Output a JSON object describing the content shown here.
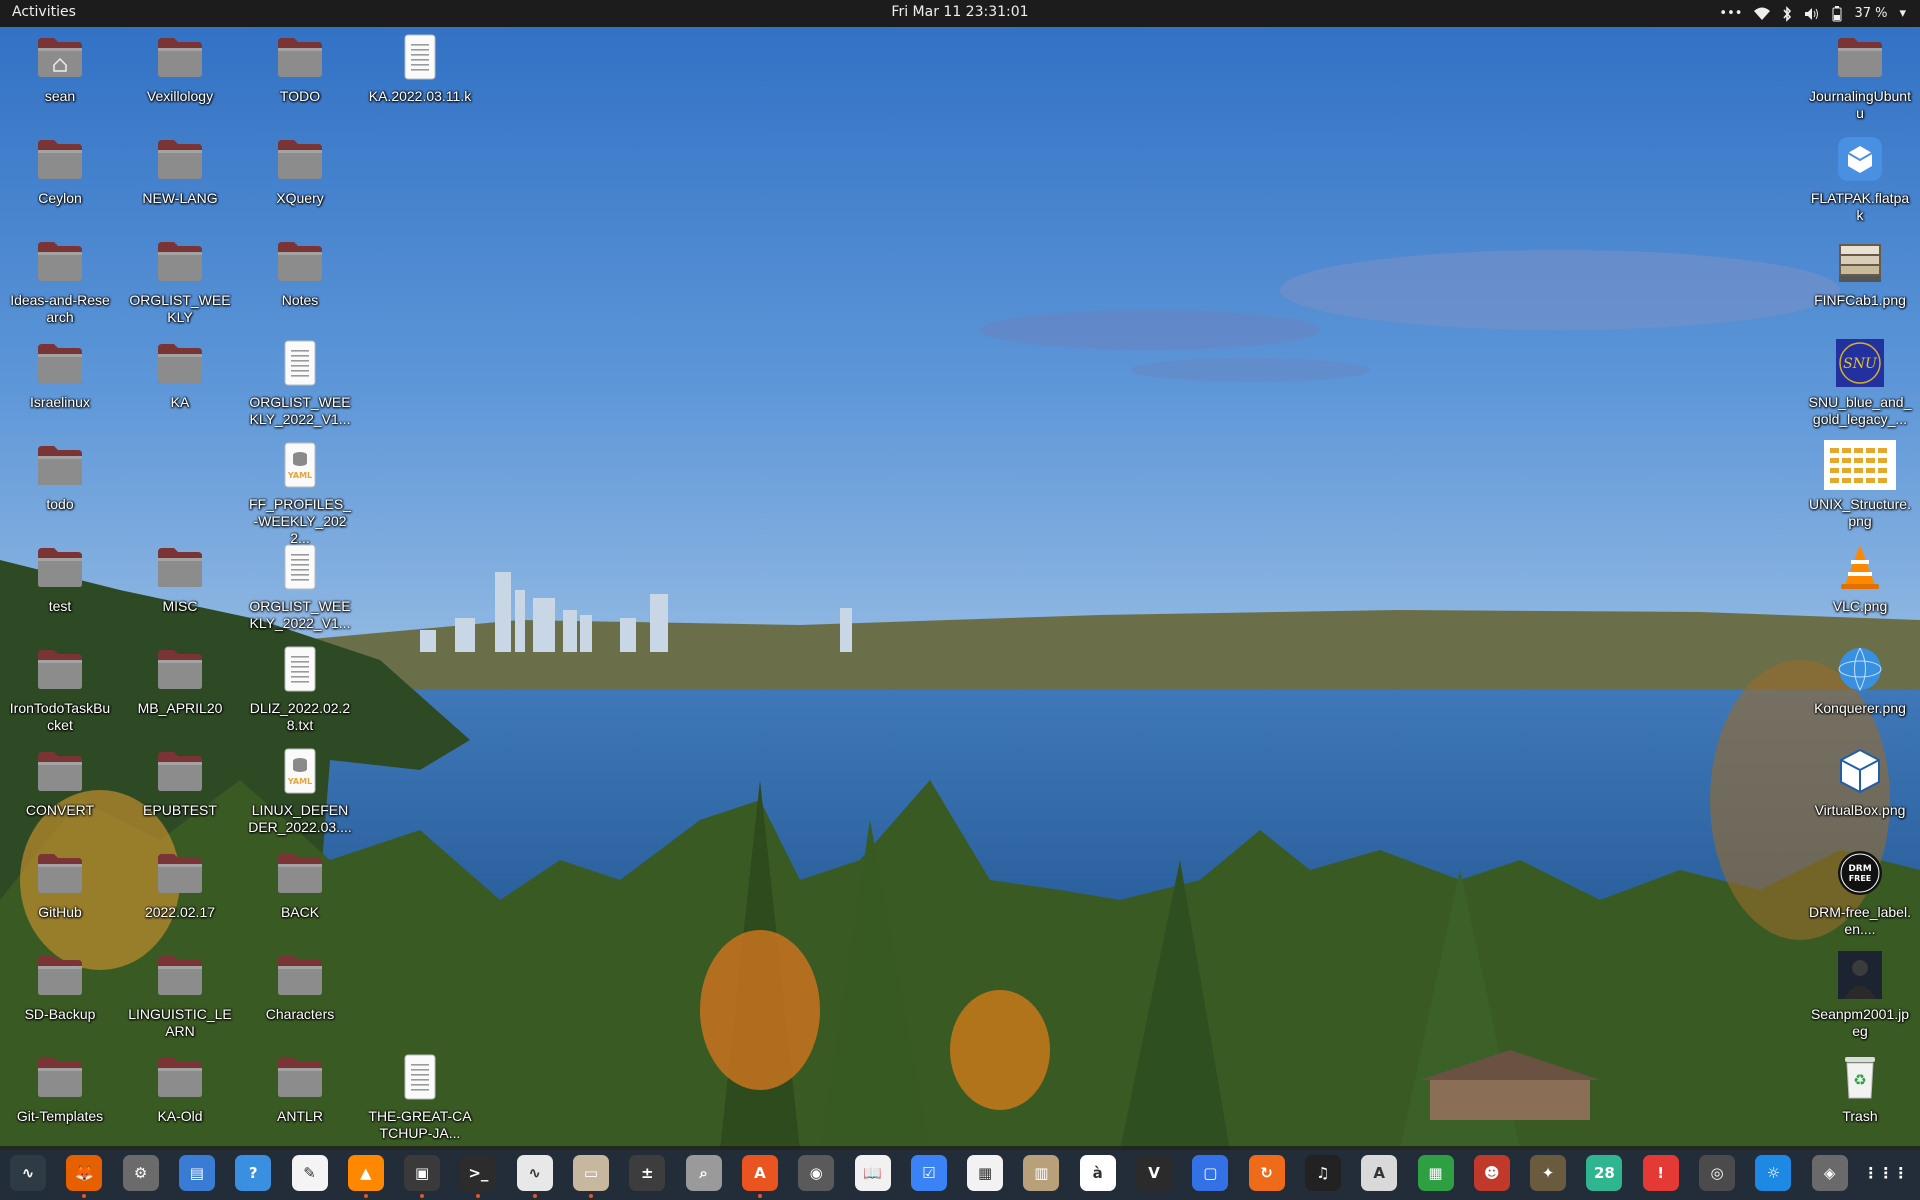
{
  "topbar": {
    "activities": "Activities",
    "clock": "Fri Mar 11  23:31:01",
    "battery": "37 %"
  },
  "desktop": {
    "left_icons": [
      {
        "label": "sean",
        "kind": "home-folder-icon"
      },
      {
        "label": "Vexillology",
        "kind": "folder-icon"
      },
      {
        "label": "TODO",
        "kind": "folder-icon"
      },
      {
        "label": "KA.2022.03.11.k",
        "kind": "text-file-icon"
      },
      {
        "label": "Ceylon",
        "kind": "folder-icon"
      },
      {
        "label": "NEW-LANG",
        "kind": "folder-icon"
      },
      {
        "label": "XQuery",
        "kind": "folder-icon"
      },
      {
        "label": "Ideas-and-Research",
        "kind": "folder-icon"
      },
      {
        "label": "ORGLIST_WEEKLY",
        "kind": "folder-icon"
      },
      {
        "label": "Notes",
        "kind": "folder-icon"
      },
      {
        "label": "Israelinux",
        "kind": "folder-icon"
      },
      {
        "label": "KA",
        "kind": "folder-icon"
      },
      {
        "label": "ORGLIST_WEEKLY_2022_V1...",
        "kind": "text-file-icon"
      },
      {
        "label": "todo",
        "kind": "folder-icon"
      },
      {
        "label": "FF_PROFILES_-WEEKLY_2022...",
        "kind": "yaml-file-icon"
      },
      {
        "label": "test",
        "kind": "folder-icon"
      },
      {
        "label": "MISC",
        "kind": "folder-icon"
      },
      {
        "label": "ORGLIST_WEEKLY_2022_V1...",
        "kind": "text-file-icon"
      },
      {
        "label": "IronTodoTaskBucket",
        "kind": "folder-icon"
      },
      {
        "label": "MB_APRIL20",
        "kind": "folder-icon"
      },
      {
        "label": "DLIZ_2022.02.28.txt",
        "kind": "text-file-icon"
      },
      {
        "label": "CONVERT",
        "kind": "folder-icon"
      },
      {
        "label": "EPUBTEST",
        "kind": "folder-icon"
      },
      {
        "label": "LINUX_DEFENDER_2022.03....",
        "kind": "yaml-file-icon"
      },
      {
        "label": "GitHub",
        "kind": "folder-icon"
      },
      {
        "label": "2022.02.17",
        "kind": "folder-icon"
      },
      {
        "label": "BACK",
        "kind": "folder-icon"
      },
      {
        "label": "SD-Backup",
        "kind": "folder-icon"
      },
      {
        "label": "LINGUISTIC_LEARN",
        "kind": "folder-icon"
      },
      {
        "label": "Characters",
        "kind": "folder-icon"
      },
      {
        "label": "Git-Templates",
        "kind": "folder-icon"
      },
      {
        "label": "KA-Old",
        "kind": "folder-icon"
      },
      {
        "label": "ANTLR",
        "kind": "folder-icon"
      },
      {
        "label": "THE-GREAT-CATCHUP-JA...",
        "kind": "text-file-icon"
      }
    ],
    "right_icons": [
      {
        "label": "JournalingUbuntu",
        "kind": "folder-icon"
      },
      {
        "label": "FLATPAK.flatpak",
        "kind": "flatpak-icon"
      },
      {
        "label": "FINFCab1.png",
        "kind": "cabinet-image-icon"
      },
      {
        "label": "SNU_blue_and_gold_legacy_...",
        "kind": "snu-image-icon"
      },
      {
        "label": "UNIX_Structure.png",
        "kind": "diagram-image-icon"
      },
      {
        "label": "VLC.png",
        "kind": "vlc-cone-icon"
      },
      {
        "label": "Konquerer.png",
        "kind": "globe-image-icon"
      },
      {
        "label": "VirtualBox.png",
        "kind": "virtualbox-icon"
      },
      {
        "label": "DRM-free_label.en....",
        "kind": "drm-free-icon"
      },
      {
        "label": "Seanpm2001.jpeg",
        "kind": "photo-icon"
      },
      {
        "label": "Trash",
        "kind": "trash-icon"
      }
    ]
  },
  "dock": {
    "apps": [
      {
        "name": "system-monitor-icon",
        "color": "#2f3b44",
        "glyph": "∿"
      },
      {
        "name": "firefox-icon",
        "color": "#e66000",
        "glyph": "🦊"
      },
      {
        "name": "settings-icon",
        "color": "#6b6b6b",
        "glyph": "⚙"
      },
      {
        "name": "text-document-icon",
        "color": "#3a7bd5",
        "glyph": "▤"
      },
      {
        "name": "help-icon",
        "color": "#3b8fe0",
        "glyph": "?"
      },
      {
        "name": "text-editor-icon",
        "color": "#f4f4f4",
        "glyph": "✎"
      },
      {
        "name": "vlc-icon",
        "color": "#ff8800",
        "glyph": "▲"
      },
      {
        "name": "cpu-x-icon",
        "color": "#3a3a3a",
        "glyph": "▣"
      },
      {
        "name": "terminal-icon",
        "color": "#2c2c2c",
        "glyph": ">_"
      },
      {
        "name": "waveform-icon",
        "color": "#e8e8e8",
        "glyph": "∿"
      },
      {
        "name": "files-icon",
        "color": "#c8b79f",
        "glyph": "▭"
      },
      {
        "name": "calculator-icon",
        "color": "#3d3d3d",
        "glyph": "±"
      },
      {
        "name": "image-viewer-icon",
        "color": "#9a9a9a",
        "glyph": "⌕"
      },
      {
        "name": "software-center-icon",
        "color": "#e95420",
        "glyph": "A"
      },
      {
        "name": "disks-icon",
        "color": "#5a5a5a",
        "glyph": "◉"
      },
      {
        "name": "book-reader-icon",
        "color": "#f1f1f1",
        "glyph": "📖"
      },
      {
        "name": "tasks-icon",
        "color": "#3b82f6",
        "glyph": "☑"
      },
      {
        "name": "document-viewer-icon",
        "color": "#f2f2f2",
        "glyph": "▦"
      },
      {
        "name": "archive-manager-icon",
        "color": "#b8a07a",
        "glyph": "▥"
      },
      {
        "name": "character-map-icon",
        "color": "#ffffff",
        "glyph": "à"
      },
      {
        "name": "vim-icon",
        "color": "#2b2b2b",
        "glyph": "V"
      },
      {
        "name": "remote-desktop-icon",
        "color": "#3571e6",
        "glyph": "▢"
      },
      {
        "name": "updates-icon",
        "color": "#ef6b1a",
        "glyph": "↻"
      },
      {
        "name": "music-icon",
        "color": "#222222",
        "glyph": "♫"
      },
      {
        "name": "pdf-viewer-icon",
        "color": "#d9d9d9",
        "glyph": "A"
      },
      {
        "name": "spreadsheet-icon",
        "color": "#2ea043",
        "glyph": "▦"
      },
      {
        "name": "game-icon",
        "color": "#c0392b",
        "glyph": "☻"
      },
      {
        "name": "gimp-icon",
        "color": "#6b5b3e",
        "glyph": "✦"
      },
      {
        "name": "calendar-icon",
        "color": "#2fb58f",
        "glyph": "28"
      },
      {
        "name": "alert-icon",
        "color": "#e53935",
        "glyph": "!"
      },
      {
        "name": "screenshot-icon",
        "color": "#4b4b4b",
        "glyph": "◎"
      },
      {
        "name": "weather-icon",
        "color": "#1e88e5",
        "glyph": "☼"
      },
      {
        "name": "startup-disk-icon",
        "color": "#6a6a6a",
        "glyph": "◈"
      },
      {
        "name": "show-apps-icon",
        "color": "transparent",
        "glyph": "⋮⋮⋮"
      }
    ]
  }
}
